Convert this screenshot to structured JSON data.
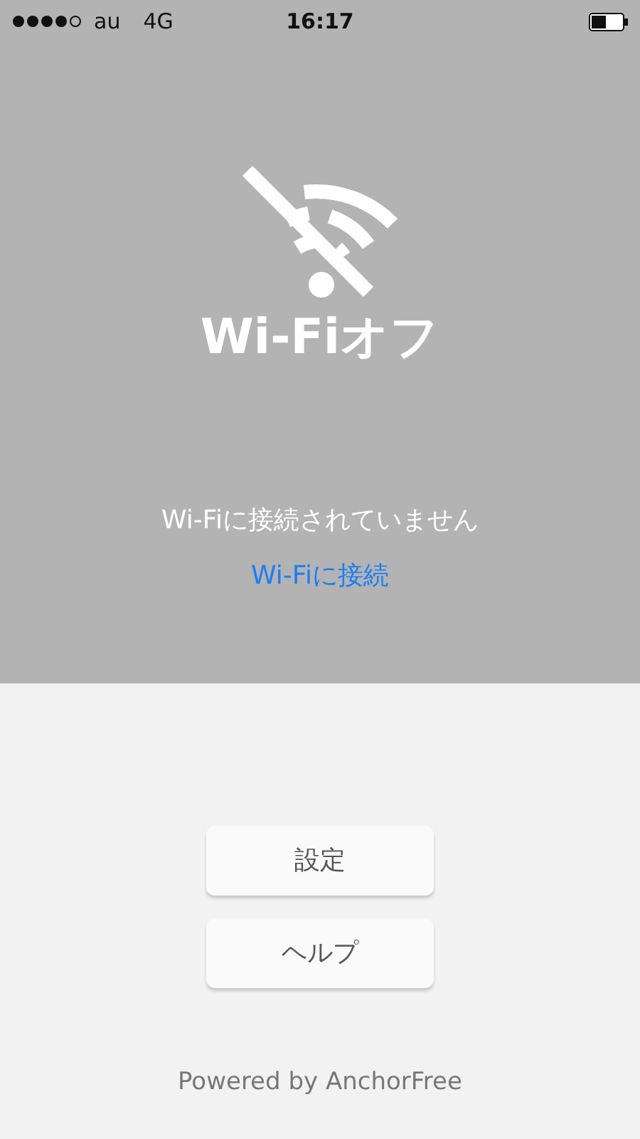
{
  "status_bar": {
    "carrier": "au",
    "network": "4G",
    "time": "16:17"
  },
  "hero": {
    "title": "Wi-Fiオフ",
    "message": "Wi-Fiに接続されていません",
    "link": "Wi-Fiに接続"
  },
  "buttons": [
    "設定",
    "ヘルプ"
  ],
  "footer": "Powered by AnchorFree"
}
